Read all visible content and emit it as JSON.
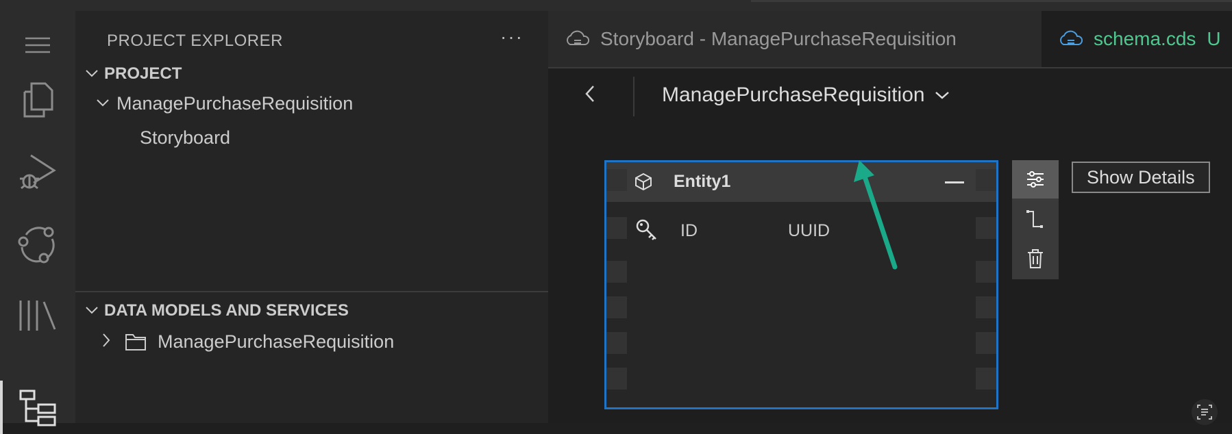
{
  "sidebar": {
    "title": "PROJECT EXPLORER",
    "more": "···",
    "project_section": "PROJECT",
    "project_items": [
      "ManagePurchaseRequisition",
      "Storyboard"
    ],
    "data_section": "DATA MODELS AND SERVICES",
    "data_items": [
      "ManagePurchaseRequisition"
    ]
  },
  "activity": {
    "icons": [
      "menu-icon",
      "explorer-icon",
      "run-debug-icon",
      "source-control-icon",
      "library-icon",
      "storyboard-icon"
    ]
  },
  "tabs": [
    {
      "label": "Storyboard - ManagePurchaseRequisition",
      "icon": "storyboard-cloud-icon"
    },
    {
      "label": "schema.cds",
      "badge": "U",
      "color": "#4ec98f"
    }
  ],
  "breadcrumb": {
    "back": "‹",
    "title": "ManagePurchaseRequisition"
  },
  "entity": {
    "name": "Entity1",
    "attributes": [
      {
        "name": "ID",
        "type": "UUID",
        "key": true
      }
    ]
  },
  "tools": [
    "properties-icon",
    "association-icon",
    "delete-icon"
  ],
  "show_details": "Show Details",
  "colors": {
    "selection_border": "#1f74c6",
    "arrow": "#1aaa8a",
    "tab_active_text": "#4ec98f"
  }
}
